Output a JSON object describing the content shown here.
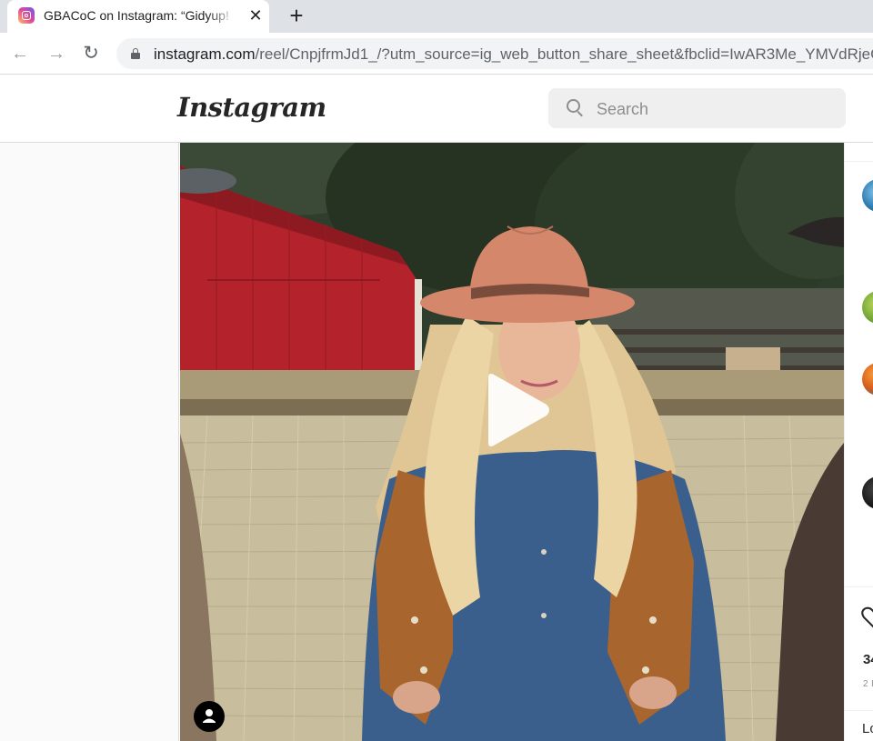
{
  "browser": {
    "tab_title": "GBACoC on Instagram: “Gidyup!",
    "tab_close": "✕",
    "new_tab": "+",
    "url_host": "instagram.com",
    "url_path": "/reel/CnpjfrmJd1_/?utm_source=ig_web_button_share_sheet&fbclid=IwAR3Me_YMVdRjeC",
    "nav": {
      "back": "←",
      "forward": "→",
      "reload": "↻"
    }
  },
  "header": {
    "logo": "Instagram",
    "search_placeholder": "Search"
  },
  "side_panel": {
    "likes_partial": "34",
    "date_partial": "2 I",
    "login_partial": "Lo"
  },
  "icons": {
    "favicon": "instagram-icon",
    "lock": "lock-icon",
    "search": "search-icon",
    "play": "play-icon",
    "account": "account-icon",
    "heart": "heart-icon"
  },
  "colors": {
    "barn_red": "#c0242c",
    "hat": "#d4876a",
    "denim": "#3b5f8c",
    "hay": "#c8bd9c"
  }
}
